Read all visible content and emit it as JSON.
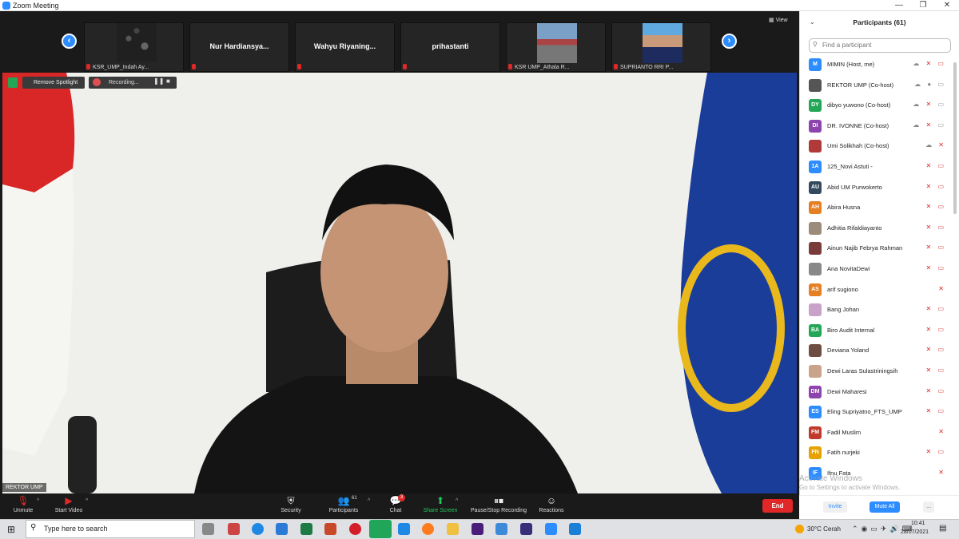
{
  "window": {
    "title": "Zoom Meeting",
    "minimize": "—",
    "restore": "❐",
    "close": "✕"
  },
  "gallery": {
    "view_label": "View",
    "prev": "‹",
    "next": "›",
    "thumbs": [
      {
        "name": "",
        "label": "KSR_UMP_Indah Ay..."
      },
      {
        "name": "Nur  Hardiansya...",
        "label": ""
      },
      {
        "name": "Wahyu  Riyaning...",
        "label": ""
      },
      {
        "name": "prihastanti",
        "label": ""
      },
      {
        "name": "",
        "label": "KSR UMP_Athala R..."
      },
      {
        "name": "",
        "label": "SUPRIANTO RRI P..."
      }
    ]
  },
  "overlay": {
    "remove_spotlight": "Remove Spotlight",
    "recording": "Recording...",
    "speaker": "REKTOR UMP"
  },
  "toolbar": {
    "unmute": "Unmute",
    "start_video": "Start Video",
    "security": "Security",
    "participants": "Participants",
    "participants_count": "61",
    "chat": "Chat",
    "chat_badge": "3",
    "share_screen": "Share Screen",
    "pause_stop": "Pause/Stop Recording",
    "reactions": "Reactions",
    "end": "End"
  },
  "panel": {
    "title": "Participants (61)",
    "search_placeholder": "Find a participant",
    "invite": "Invite",
    "mute_all": "Mute All",
    "more": "...",
    "participants": [
      {
        "initials": "M",
        "color": "#2d8cff",
        "name": "MIMIN (Host, me)"
      },
      {
        "initials": "",
        "color": "#555555",
        "name": "REKTOR UMP (Co-host)"
      },
      {
        "initials": "DY",
        "color": "#23a757",
        "name": "dibyo yuwono (Co-host)"
      },
      {
        "initials": "DI",
        "color": "#8e44ad",
        "name": "DR. IVONNE (Co-host)"
      },
      {
        "initials": "",
        "color": "#b03a3a",
        "name": "Umi Solikhah (Co-host)"
      },
      {
        "initials": "1A",
        "color": "#2d8cff",
        "name": "125_Novi Astuti -"
      },
      {
        "initials": "AU",
        "color": "#34495e",
        "name": "Abid UM Purwokerto"
      },
      {
        "initials": "AH",
        "color": "#e67e22",
        "name": "Abira Husna"
      },
      {
        "initials": "",
        "color": "#9b8b7a",
        "name": "Adhitia Rifaldiayanto"
      },
      {
        "initials": "",
        "color": "#7a3b3b",
        "name": "Ainun Najib Febrya Rahman"
      },
      {
        "initials": "",
        "color": "#888888",
        "name": "Ana NovitaDewi"
      },
      {
        "initials": "AS",
        "color": "#e67e22",
        "name": "arif sugiono"
      },
      {
        "initials": "",
        "color": "#c8a2c8",
        "name": "Bang Johan"
      },
      {
        "initials": "BA",
        "color": "#23a757",
        "name": "Biro Audit Internal"
      },
      {
        "initials": "",
        "color": "#6d4c41",
        "name": "Deviana Yoland"
      },
      {
        "initials": "",
        "color": "#caa48a",
        "name": "Dewi Laras Sulastriningsih"
      },
      {
        "initials": "DM",
        "color": "#8e44ad",
        "name": "Dewi Maharesi"
      },
      {
        "initials": "ES",
        "color": "#2d8cff",
        "name": "Eling Supriyatno_FTS_UMP"
      },
      {
        "initials": "FM",
        "color": "#c0392b",
        "name": "Fadil Muslim"
      },
      {
        "initials": "FN",
        "color": "#e6a200",
        "name": "Fatih nurjeki"
      },
      {
        "initials": "IF",
        "color": "#2d8cff",
        "name": "Ifnu Fata"
      }
    ]
  },
  "activate": {
    "line1": "Activate Windows",
    "line2": "Go to Settings to activate Windows."
  },
  "taskbar": {
    "search_placeholder": "Type here to search",
    "weather": "30°C  Cerah",
    "time": "10:41",
    "date": "28/07/2021"
  },
  "colors": {
    "accent": "#2d8cff",
    "mute_red": "#e02828",
    "share_green": "#23a757"
  }
}
